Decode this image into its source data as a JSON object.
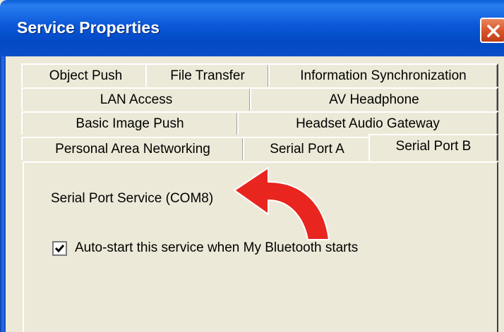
{
  "window": {
    "title": "Service Properties"
  },
  "tabs": {
    "row1": [
      "Object Push",
      "File Transfer",
      "Information Synchronization"
    ],
    "row2": [
      "LAN Access",
      "AV Headphone"
    ],
    "row3": [
      "Basic Image Push",
      "Headset Audio Gateway"
    ],
    "row4": [
      "Personal Area Networking",
      "Serial Port A",
      "Serial Port B"
    ],
    "selected": "Serial Port B"
  },
  "panel": {
    "service_name": "Serial Port Service (COM8)",
    "autostart_label": "Auto-start this service when My Bluetooth starts",
    "autostart_checked": true
  },
  "annotation": {
    "arrow_color": "#e8251f"
  },
  "icons": {
    "close": "close-icon",
    "check": "check-icon",
    "arrow": "curved-arrow-icon"
  }
}
